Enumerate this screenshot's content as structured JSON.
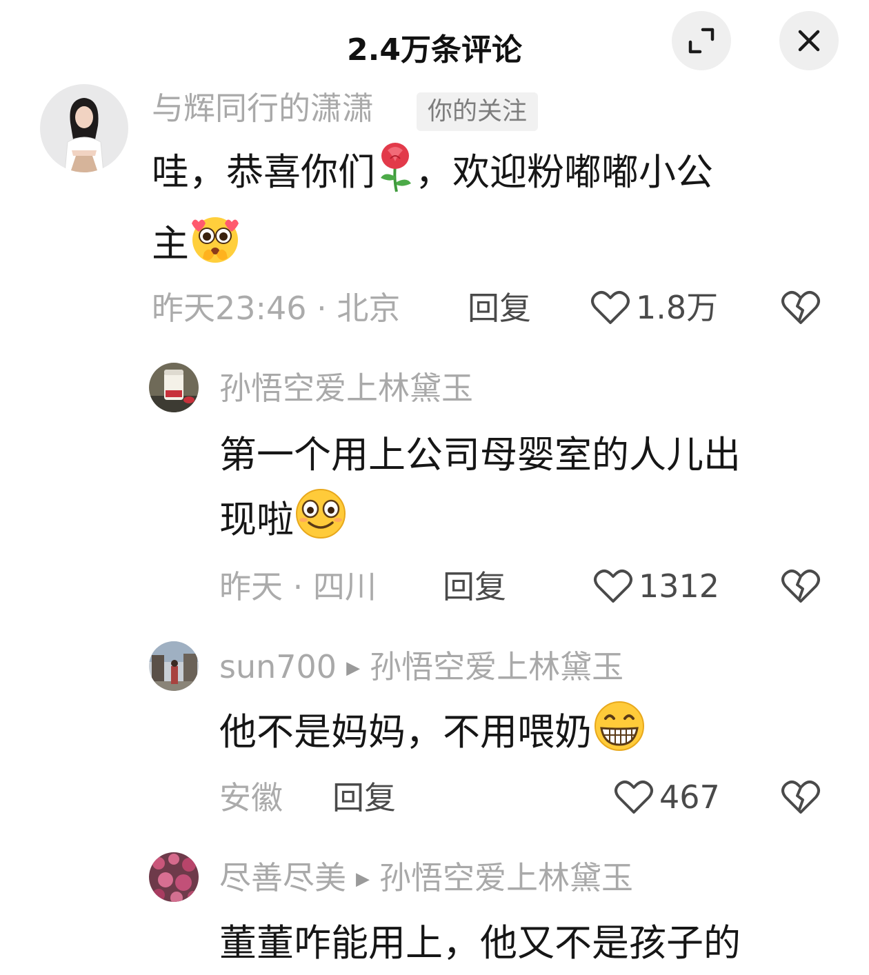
{
  "header": {
    "title": "2.4万条评论",
    "expand_icon": "expand-icon",
    "close_icon": "close-icon"
  },
  "comments": [
    {
      "username": "与辉同行的潇潇",
      "tag": "你的关注",
      "text_line1": "哇，恭喜你们",
      "text_line1_after": "，欢迎粉嘟嘟小公",
      "text_line2": "主",
      "emojis": [
        "rose-emoji",
        "pleading-emoji"
      ],
      "meta": "昨天23:46 · 北京",
      "reply_label": "回复",
      "likes": "1.8万"
    },
    {
      "username": "孙悟空爱上林黛玉",
      "text_line1": "第一个用上公司母婴室的人儿出",
      "text_line2": "现啦",
      "emojis": [
        "smile-emoji"
      ],
      "meta": "昨天 · 四川",
      "reply_label": "回复",
      "likes": "1312"
    },
    {
      "username": "sun700",
      "reply_to": "孙悟空爱上林黛玉",
      "text_line1": "他不是妈妈，不用喂奶",
      "emojis": [
        "grin-emoji"
      ],
      "meta": "安徽",
      "reply_label": "回复",
      "likes": "467"
    },
    {
      "username": "尽善尽美",
      "reply_to": "孙悟空爱上林黛玉",
      "text_line1": "董董咋能用上，他又不是孩子的"
    }
  ],
  "colors": {
    "muted": "#a9a9a9",
    "text": "#161616",
    "action": "#4a4a4a",
    "button_bg": "#efefef"
  }
}
